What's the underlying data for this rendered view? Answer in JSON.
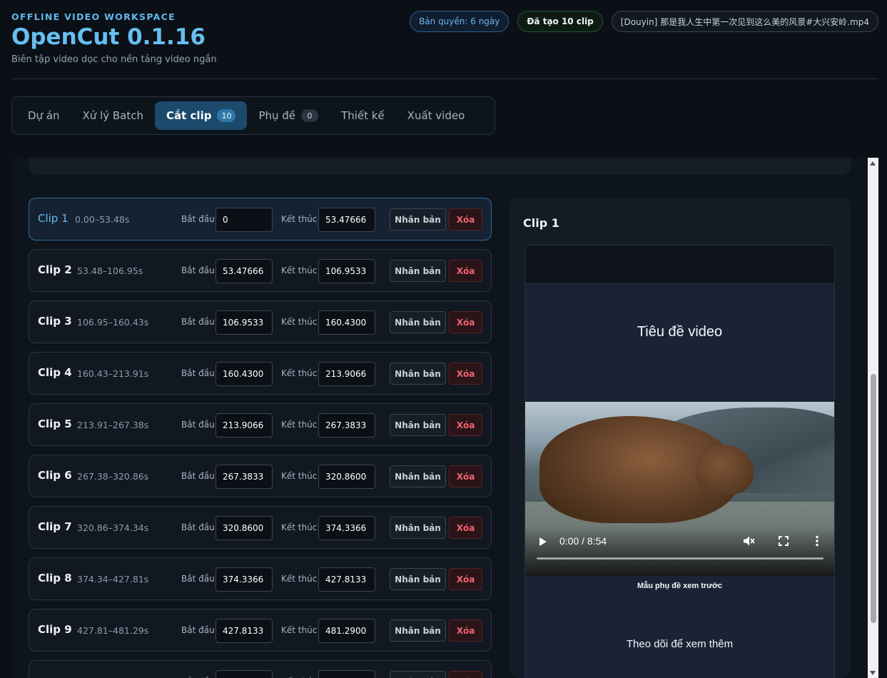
{
  "header": {
    "eyebrow": "OFFLINE VIDEO WORKSPACE",
    "title": "OpenCut 0.1.16",
    "subtitle": "Biên tập video dọc cho nền tảng video ngắn"
  },
  "badges": {
    "license": "Bản quyền: 6 ngày",
    "trained": "Đã tạo 10 clip",
    "file": "[Douyin] 那是我人生中第一次见到这么美的风景#大兴安岭.mp4"
  },
  "tabs": [
    {
      "label": "Dự án"
    },
    {
      "label": "Xử lý Batch"
    },
    {
      "label": "Cắt clip",
      "count": "10"
    },
    {
      "label": "Phụ đề",
      "count": "0"
    },
    {
      "label": "Thiết kế"
    },
    {
      "label": "Xuất video"
    }
  ],
  "clip_labels": {
    "start": "Bắt đầu",
    "end": "Kết thúc",
    "duplicate": "Nhân bản",
    "delete": "Xóa"
  },
  "clips": [
    {
      "name": "Clip 1",
      "range": "0.00–53.48s",
      "start": "0",
      "end": "53.47666"
    },
    {
      "name": "Clip 2",
      "range": "53.48–106.95s",
      "start": "53.47666",
      "end": "106.9533"
    },
    {
      "name": "Clip 3",
      "range": "106.95–160.43s",
      "start": "106.9533",
      "end": "160.4300"
    },
    {
      "name": "Clip 4",
      "range": "160.43–213.91s",
      "start": "160.4300",
      "end": "213.9066"
    },
    {
      "name": "Clip 5",
      "range": "213.91–267.38s",
      "start": "213.9066",
      "end": "267.3833"
    },
    {
      "name": "Clip 6",
      "range": "267.38–320.86s",
      "start": "267.3833",
      "end": "320.8600"
    },
    {
      "name": "Clip 7",
      "range": "320.86–374.34s",
      "start": "320.8600",
      "end": "374.3366"
    },
    {
      "name": "Clip 8",
      "range": "374.34–427.81s",
      "start": "374.3366",
      "end": "427.8133"
    },
    {
      "name": "Clip 9",
      "range": "427.81–481.29s",
      "start": "427.8133",
      "end": "481.2900"
    },
    {
      "name": "",
      "range": "",
      "start": "",
      "end": ""
    }
  ],
  "preview": {
    "title": "Clip 1",
    "video_title": "Tiêu đề video",
    "time": "0:00 / 8:54",
    "subtitle_sample": "Mẫu phụ đề xem trước",
    "follow_text": "Theo dõi để xem thêm"
  }
}
